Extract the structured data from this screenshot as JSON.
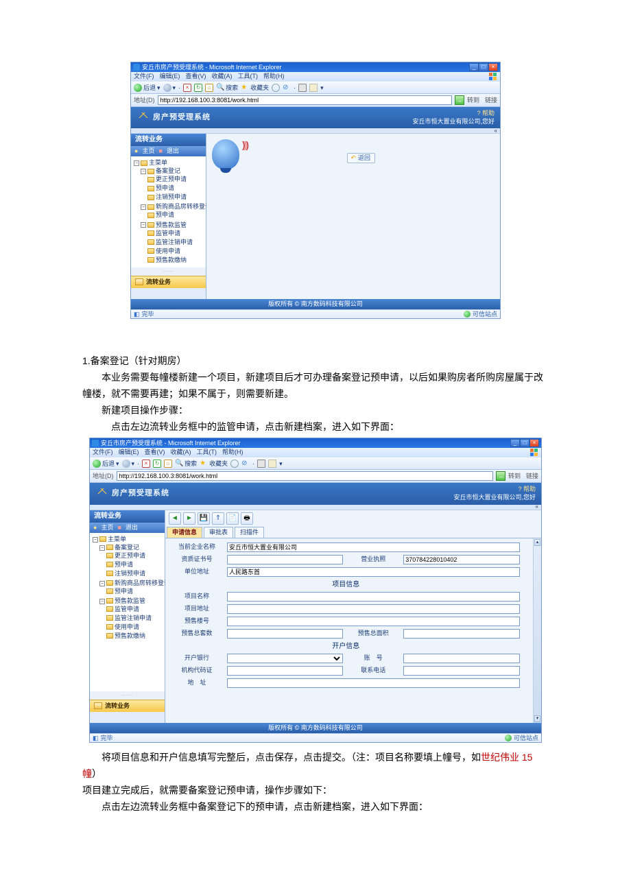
{
  "ie": {
    "title": "安丘市房产预受理系统 - Microsoft Internet Explorer",
    "menus": {
      "file": "文件(F)",
      "edit": "编辑(E)",
      "view": "查看(V)",
      "fav": "收藏(A)",
      "tools": "工具(T)",
      "help": "帮助(H)"
    },
    "tb": {
      "back": "后退",
      "search": "搜索",
      "fav": "收藏夹"
    },
    "addr_label": "地址(D)",
    "url": "http://192.168.100.3:8081/work.html",
    "go": "转到",
    "links": "链接",
    "done": "完毕",
    "zone": "可信站点"
  },
  "app": {
    "title": "房产预受理系统",
    "help": "? 帮助",
    "welcome": "安丘市恒大置业有限公司,您好",
    "footer": "版权所有 © 南方数码科技有限公司"
  },
  "sidebar": {
    "title": "流转业务",
    "home": "主页",
    "logout": "退出",
    "root": "主菜单",
    "bottom": "流转业务",
    "groups": [
      {
        "label": "备案登记",
        "children": [
          "更正预申请",
          "预申请",
          "注销预申请"
        ]
      },
      {
        "label": "新购商品房转移登记",
        "children": [
          "预申请"
        ]
      },
      {
        "label": "预售款监管",
        "children": [
          "监管申请",
          "监管注销申请",
          "使用申请",
          "预售款缴纳"
        ]
      }
    ]
  },
  "s1": {
    "return_btn": "返回"
  },
  "apheader_small": "«",
  "s2": {
    "tabs": {
      "t1": "申请信息",
      "t2": "审批表",
      "t3": "扫描件"
    },
    "icons": {
      "prev": "◄",
      "next": "►",
      "save": "💾",
      "submit": "⇑",
      "new": "📄",
      "print": "🖶"
    },
    "fields": {
      "company_lbl": "当前企业名称",
      "company_val": "安丘市恒大置业有限公司",
      "cert_lbl": "资质证书号",
      "license_lbl": "营业执照",
      "license_val": "370784228010402",
      "addr_lbl": "单位地址",
      "addr_val": "人民路东首",
      "sec1": "项目信息",
      "proj_name_lbl": "项目名称",
      "proj_addr_lbl": "项目地址",
      "presale_no_lbl": "预售楼号",
      "presale_cnt_lbl": "预售总套数",
      "presale_area_lbl": "预售总面积",
      "sec2": "开户信息",
      "bank_lbl": "开户银行",
      "acct_lbl": "账　号",
      "org_lbl": "机构代码证",
      "tel_lbl": "联系电话",
      "addr2_lbl": "地　址"
    }
  },
  "doc": {
    "p1": "1.备案登记（针对期房）",
    "p2": "本业务需要每幢楼新建一个项目，新建项目后才可办理备案登记预申请，以后如果购房者所购房屋属于改幢楼，就不需要再建；如果不属于，则需要新建。",
    "p3": "新建项目操作步骤：",
    "p4": "点击左边流转业务框中的监管申请，点击新建档案，进入如下界面：",
    "p5a": "将项目信息和开户信息填写完整后，点击保存，点击提交。（注：项目名称要填上幢号，如",
    "p5b": "世纪伟业 15 幢",
    "p5c": "）",
    "p6": "项目建立完成后，就需要备案登记预申请，操作步骤如下：",
    "p7": "点击左边流转业务框中备案登记下的预申请，点击新建档案，进入如下界面："
  }
}
